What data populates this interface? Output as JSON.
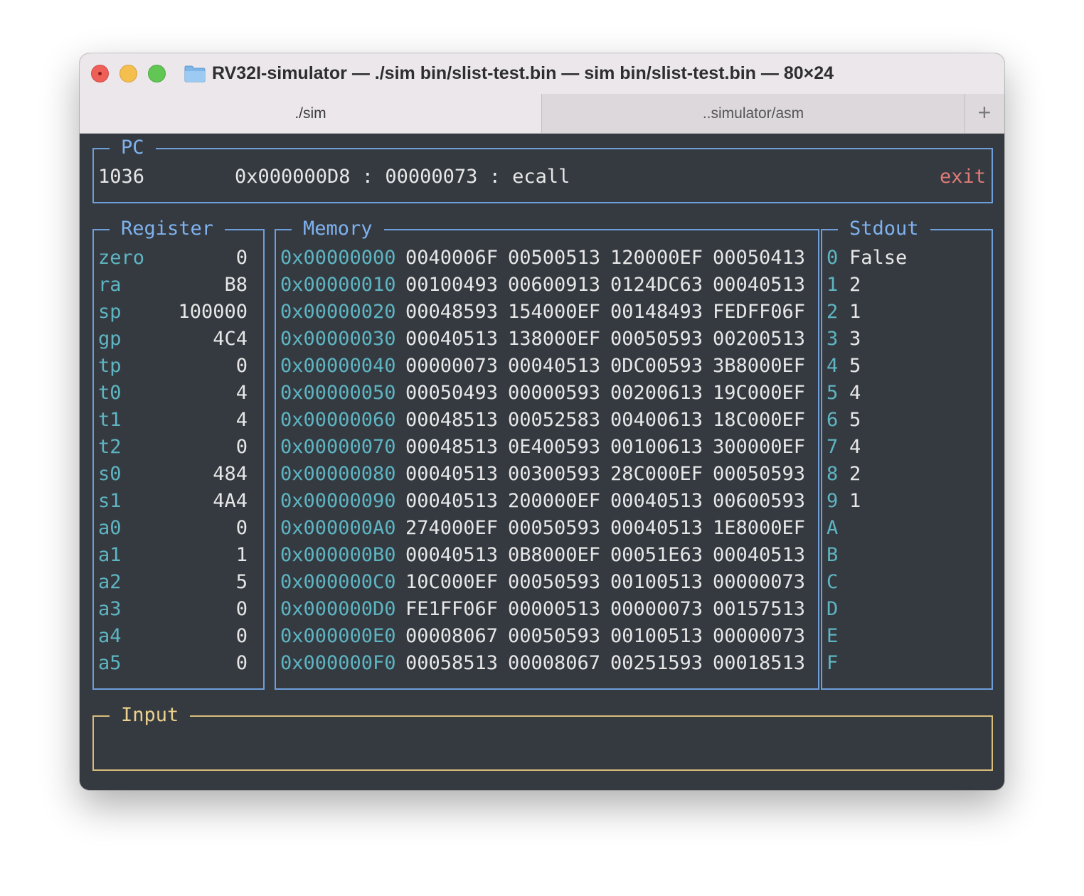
{
  "window": {
    "title": "RV32I-simulator — ./sim bin/slist-test.bin — sim bin/slist-test.bin — 80×24",
    "tabs": [
      {
        "label": "./sim",
        "active": true
      },
      {
        "label": "..simulator/asm",
        "active": false
      }
    ],
    "new_tab_label": "+"
  },
  "pc": {
    "title": "PC",
    "count": "1036",
    "instruction": "0x000000D8 : 00000073 : ecall",
    "status": "exit"
  },
  "registers": {
    "title": "Register",
    "items": [
      {
        "name": "zero",
        "value": "0"
      },
      {
        "name": "ra",
        "value": "B8"
      },
      {
        "name": "sp",
        "value": "100000"
      },
      {
        "name": "gp",
        "value": "4C4"
      },
      {
        "name": "tp",
        "value": "0"
      },
      {
        "name": "t0",
        "value": "4"
      },
      {
        "name": "t1",
        "value": "4"
      },
      {
        "name": "t2",
        "value": "0"
      },
      {
        "name": "s0",
        "value": "484"
      },
      {
        "name": "s1",
        "value": "4A4"
      },
      {
        "name": "a0",
        "value": "0"
      },
      {
        "name": "a1",
        "value": "1"
      },
      {
        "name": "a2",
        "value": "5"
      },
      {
        "name": "a3",
        "value": "0"
      },
      {
        "name": "a4",
        "value": "0"
      },
      {
        "name": "a5",
        "value": "0"
      }
    ]
  },
  "memory": {
    "title": "Memory",
    "highlight": {
      "row": 13,
      "col": 2
    },
    "rows": [
      {
        "addr": "0x00000000",
        "words": [
          "0040006F",
          "00500513",
          "120000EF",
          "00050413"
        ]
      },
      {
        "addr": "0x00000010",
        "words": [
          "00100493",
          "00600913",
          "0124DC63",
          "00040513"
        ]
      },
      {
        "addr": "0x00000020",
        "words": [
          "00048593",
          "154000EF",
          "00148493",
          "FEDFF06F"
        ]
      },
      {
        "addr": "0x00000030",
        "words": [
          "00040513",
          "138000EF",
          "00050593",
          "00200513"
        ]
      },
      {
        "addr": "0x00000040",
        "words": [
          "00000073",
          "00040513",
          "0DC00593",
          "3B8000EF"
        ]
      },
      {
        "addr": "0x00000050",
        "words": [
          "00050493",
          "00000593",
          "00200613",
          "19C000EF"
        ]
      },
      {
        "addr": "0x00000060",
        "words": [
          "00048513",
          "00052583",
          "00400613",
          "18C000EF"
        ]
      },
      {
        "addr": "0x00000070",
        "words": [
          "00048513",
          "0E400593",
          "00100613",
          "300000EF"
        ]
      },
      {
        "addr": "0x00000080",
        "words": [
          "00040513",
          "00300593",
          "28C000EF",
          "00050593"
        ]
      },
      {
        "addr": "0x00000090",
        "words": [
          "00040513",
          "200000EF",
          "00040513",
          "00600593"
        ]
      },
      {
        "addr": "0x000000A0",
        "words": [
          "274000EF",
          "00050593",
          "00040513",
          "1E8000EF"
        ]
      },
      {
        "addr": "0x000000B0",
        "words": [
          "00040513",
          "0B8000EF",
          "00051E63",
          "00040513"
        ]
      },
      {
        "addr": "0x000000C0",
        "words": [
          "10C000EF",
          "00050593",
          "00100513",
          "00000073"
        ]
      },
      {
        "addr": "0x000000D0",
        "words": [
          "FE1FF06F",
          "00000513",
          "00000073",
          "00157513"
        ]
      },
      {
        "addr": "0x000000E0",
        "words": [
          "00008067",
          "00050593",
          "00100513",
          "00000073"
        ]
      },
      {
        "addr": "0x000000F0",
        "words": [
          "00058513",
          "00008067",
          "00251593",
          "00018513"
        ]
      }
    ]
  },
  "stdout": {
    "title": "Stdout",
    "lines": [
      {
        "index": "0",
        "text": "False"
      },
      {
        "index": "1",
        "text": "2"
      },
      {
        "index": "2",
        "text": "1"
      },
      {
        "index": "3",
        "text": "3"
      },
      {
        "index": "4",
        "text": "5"
      },
      {
        "index": "5",
        "text": "4"
      },
      {
        "index": "6",
        "text": "5"
      },
      {
        "index": "7",
        "text": "4"
      },
      {
        "index": "8",
        "text": "2"
      },
      {
        "index": "9",
        "text": "1"
      },
      {
        "index": "A",
        "text": ""
      },
      {
        "index": "B",
        "text": ""
      },
      {
        "index": "C",
        "text": ""
      },
      {
        "index": "D",
        "text": ""
      },
      {
        "index": "E",
        "text": ""
      },
      {
        "index": "F",
        "text": ""
      }
    ]
  },
  "input": {
    "title": "Input",
    "value": ""
  }
}
